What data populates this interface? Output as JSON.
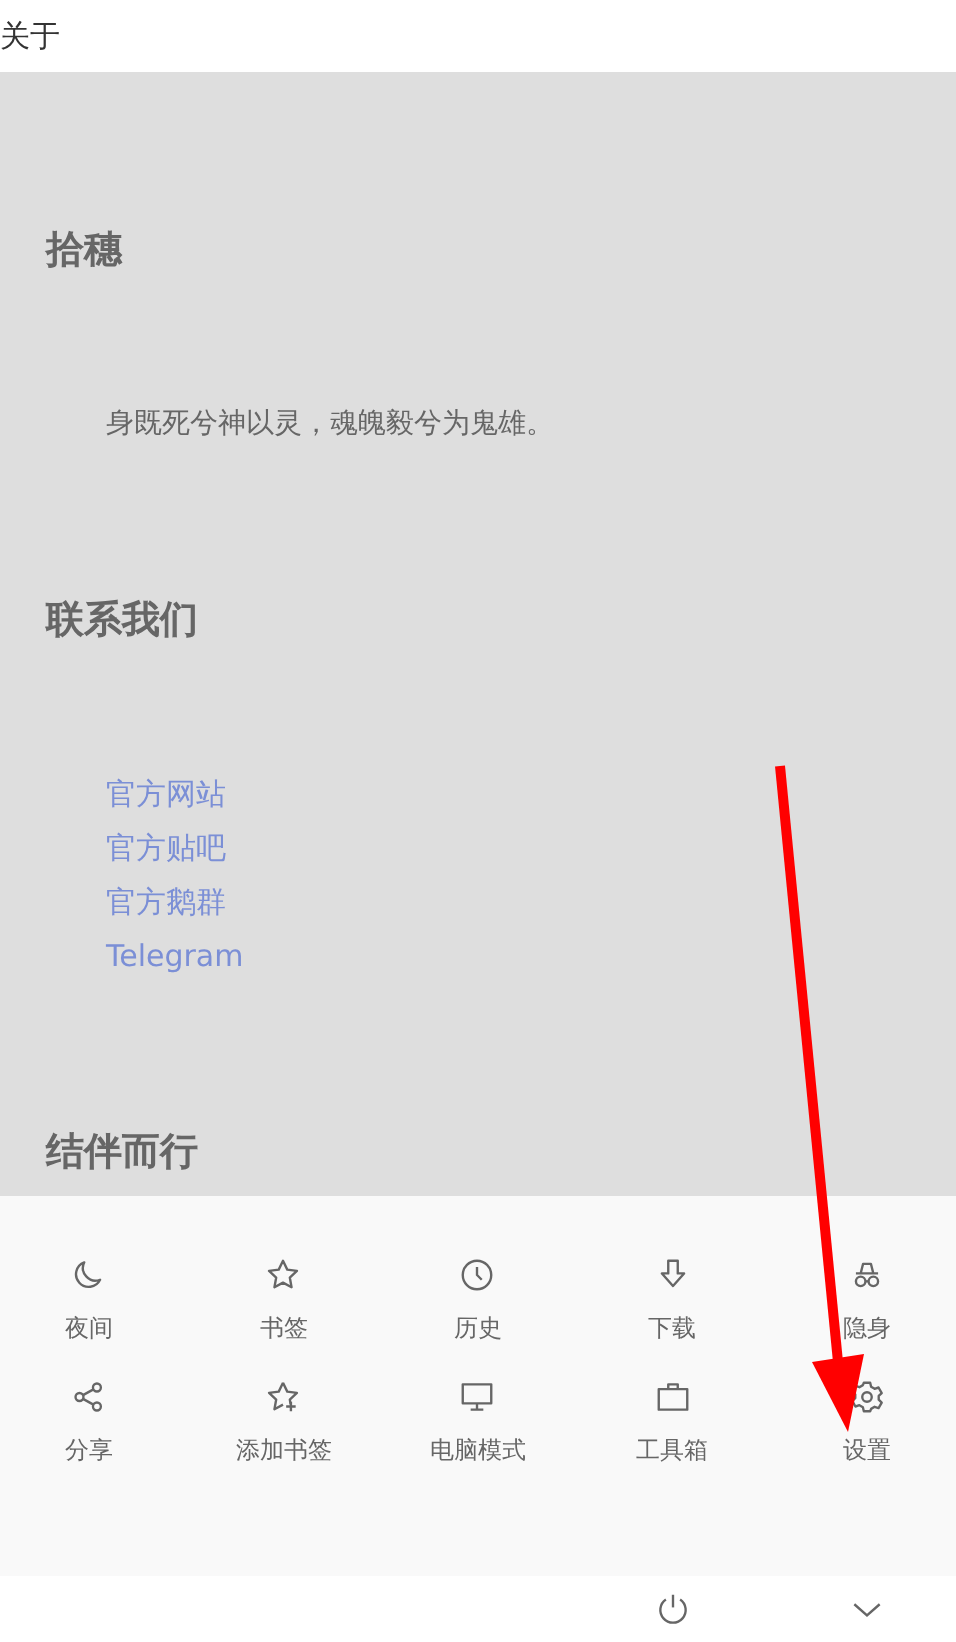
{
  "title": "关于",
  "sections": [
    {
      "heading": "拾穗",
      "kind": "text",
      "text": "身既死兮神以灵，魂魄毅兮为鬼雄。"
    },
    {
      "heading": "联系我们",
      "kind": "links",
      "links": [
        "官方网站",
        "官方贴吧",
        "官方鹅群",
        "Telegram"
      ]
    },
    {
      "heading": "结伴而行",
      "kind": "heading"
    }
  ],
  "menu": [
    {
      "kind": "moon",
      "label": "夜间"
    },
    {
      "kind": "star",
      "label": "书签"
    },
    {
      "kind": "clock",
      "label": "历史"
    },
    {
      "kind": "download",
      "label": "下载"
    },
    {
      "kind": "incognito",
      "label": "隐身"
    },
    {
      "kind": "share",
      "label": "分享"
    },
    {
      "kind": "bookmark",
      "label": "添加书签"
    },
    {
      "kind": "monitor",
      "label": "电脑模式"
    },
    {
      "kind": "toolbox",
      "label": "工具箱"
    },
    {
      "kind": "gear",
      "label": "设置"
    }
  ],
  "bottom_bar": [
    {
      "kind": "power"
    },
    {
      "kind": "chevron"
    }
  ],
  "annotation": {
    "kind": "arrow"
  }
}
